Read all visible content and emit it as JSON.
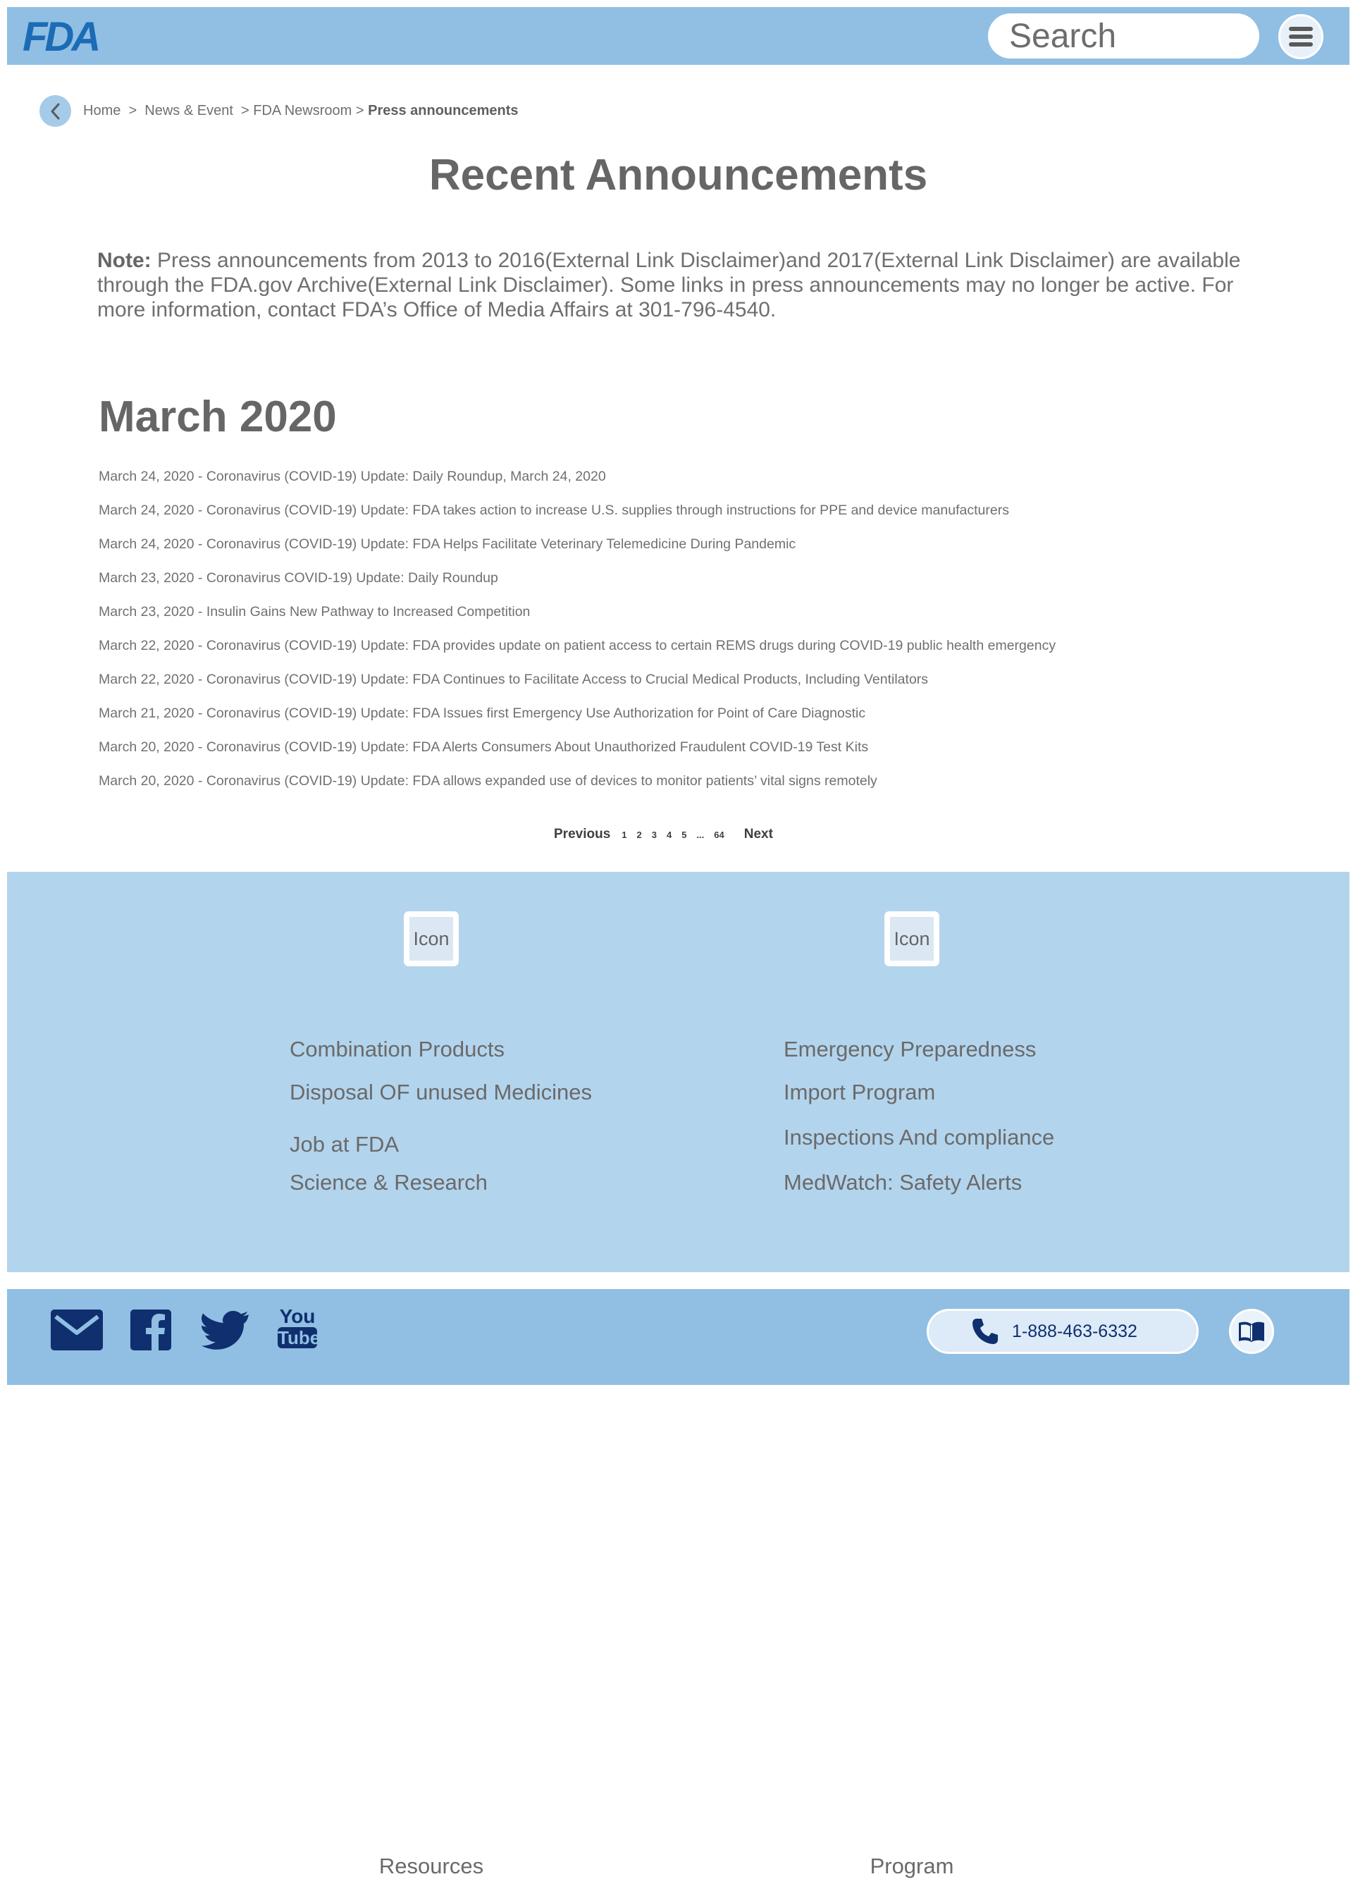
{
  "header": {
    "logo_text": "FDA",
    "search_placeholder": "Search",
    "menu_icon": "hamburger-menu-icon"
  },
  "breadcrumb": {
    "items": [
      "Home",
      "News & Event",
      "FDA Newsroom"
    ],
    "current": "Press announcements"
  },
  "page": {
    "title": "Recent Announcements",
    "note_label": "Note:",
    "note_text": "Press announcements from 2013 to 2016(External Link Disclaimer)and 2017(External Link Disclaimer) are available through the FDA.gov Archive(External Link Disclaimer). Some links in press announcements may no longer be active. For more information, contact FDA’s Office of Media Affairs at 301-796-4540.",
    "month_heading": "March 2020"
  },
  "announcements": [
    "March 24, 2020 - Coronavirus (COVID-19) Update: Daily Roundup, March 24, 2020",
    "March 24, 2020 - Coronavirus (COVID-19) Update: FDA takes action to increase U.S. supplies through instructions for PPE and device manufacturers",
    "March 24, 2020 - Coronavirus (COVID-19) Update: FDA Helps Facilitate Veterinary Telemedicine During Pandemic",
    "March 23, 2020 - Coronavirus COVID-19) Update: Daily Roundup",
    "March 23, 2020 - Insulin Gains New Pathway to Increased Competition",
    "March 22, 2020 - Coronavirus (COVID-19) Update: FDA provides update on patient access to certain REMS drugs during COVID-19 public health emergency",
    "March 22, 2020 - Coronavirus (COVID-19) Update: FDA Continues to Facilitate Access to Crucial Medical Products, Including Ventilators",
    "March 21, 2020 - Coronavirus (COVID-19) Update: FDA Issues first Emergency Use Authorization for Point of Care Diagnostic",
    "March 20, 2020 - Coronavirus (COVID-19) Update: FDA Alerts Consumers About Unauthorized Fraudulent COVID-19 Test Kits",
    "March 20, 2020 - Coronavirus (COVID-19) Update: FDA allows expanded use of devices to monitor patients’ vital signs remotely"
  ],
  "pagination": {
    "previous": "Previous",
    "pages": [
      "1",
      "2",
      "3",
      "4",
      "5",
      "...",
      "64"
    ],
    "next": "Next"
  },
  "footer": {
    "resources": {
      "icon_label": "Icon",
      "title": "Resources",
      "links": [
        "Combination Products",
        "Disposal OF unused Medicines",
        "Job at FDA",
        "Science & Research"
      ]
    },
    "program": {
      "icon_label": "Icon",
      "title": "Program",
      "links": [
        "Emergency Preparedness",
        "Import Program",
        "Inspections And compliance",
        "MedWatch: Safety Alerts"
      ]
    }
  },
  "bottom": {
    "social": [
      "mail-icon",
      "facebook-icon",
      "twitter-icon",
      "youtube-icon"
    ],
    "youtube_text_top": "You",
    "youtube_text_bottom": "Tube",
    "phone": "1-888-463-6332",
    "accent_color": "#0f2f6e",
    "bar_color": "#90bfe3",
    "footer_color": "#b3d4ed"
  }
}
